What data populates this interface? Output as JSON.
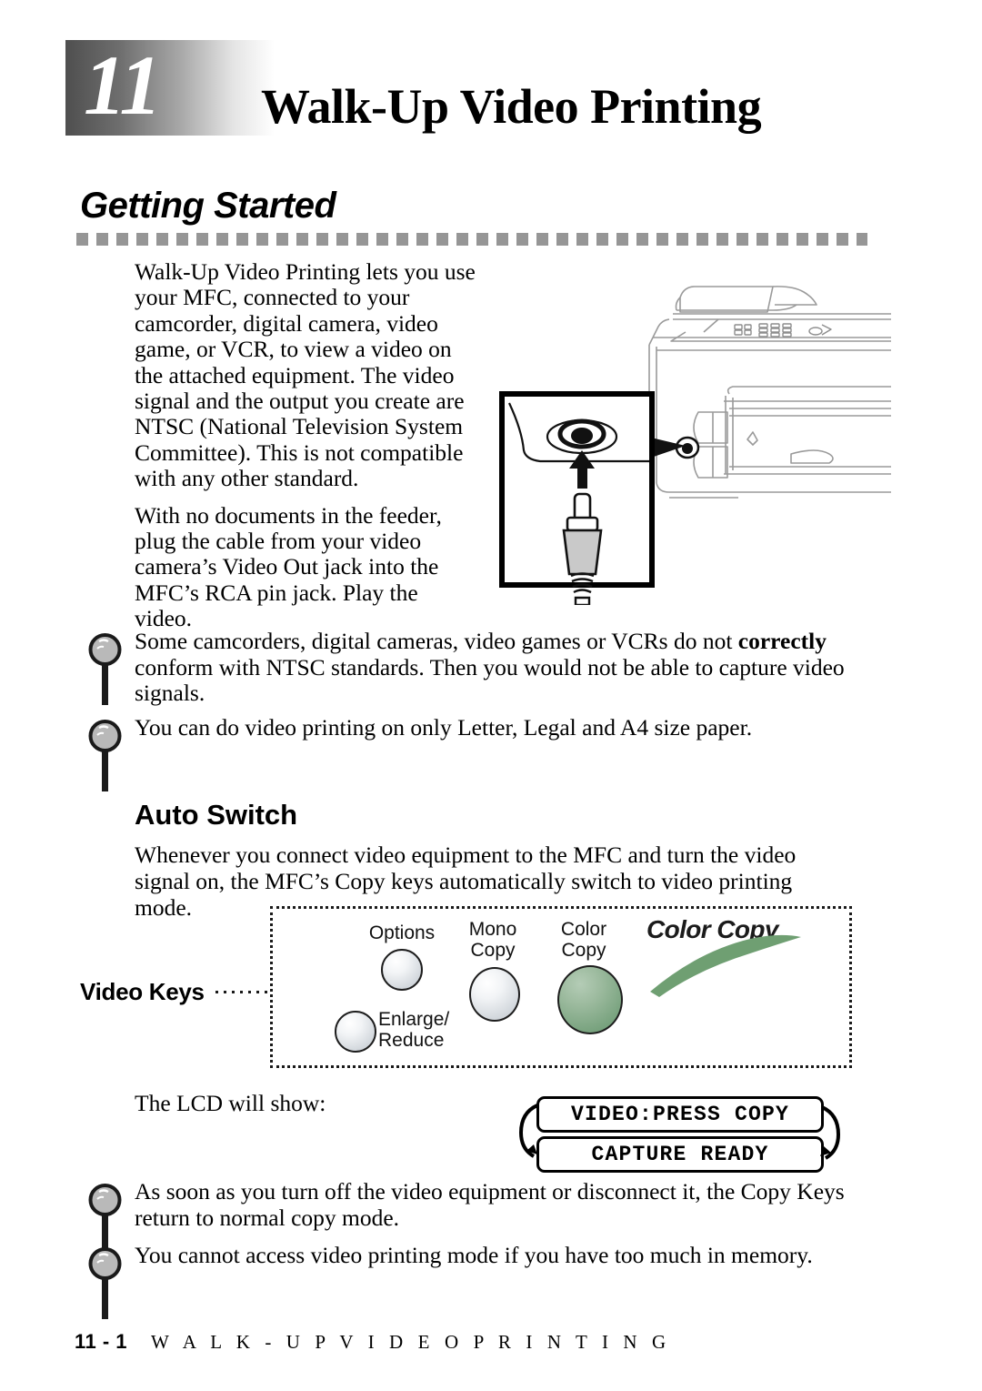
{
  "chapter": {
    "number": "11",
    "title": "Walk-Up Video Printing"
  },
  "section": {
    "heading": "Getting Started",
    "paragraphs": [
      "Walk-Up Video Printing lets you use your MFC, connected to your camcorder, digital camera, video game, or VCR, to view a video on the attached equipment. The video signal and the output you create are NTSC (National Television System Committee). This is not compatible with any other standard.",
      "With no documents in the feeder, plug the cable from your video camera’s Video Out jack into the MFC’s RCA pin jack. Play the video."
    ]
  },
  "notes_top": [
    {
      "icon": "magnifier-icon",
      "text_before": "Some camcorders, digital cameras, video games or VCRs do not ",
      "bold": "correctly",
      "text_after": " conform with NTSC standards. Then you would not be able to capture video signals."
    },
    {
      "icon": "magnifier-icon",
      "text_before": "You can do video printing on only Letter, Legal and A4 size paper.",
      "bold": "",
      "text_after": ""
    }
  ],
  "auto_switch": {
    "heading": "Auto Switch",
    "paragraph": "Whenever you connect video equipment to the MFC and turn the video signal on, the MFC’s Copy keys automatically switch to video printing mode."
  },
  "panel": {
    "callout_label": "Video Keys",
    "logo_text": "Color Copy",
    "logo_accent_color": "#6f9f72",
    "buttons": [
      {
        "label": "Options",
        "size": "small",
        "color": "#d8dde2"
      },
      {
        "label": "Enlarge/\nReduce",
        "size": "small",
        "color": "#d8dde2"
      },
      {
        "label": "Mono\nCopy",
        "size": "medium",
        "color": "#d8dde2"
      },
      {
        "label": "Color\nCopy",
        "size": "large",
        "color": "#7da585"
      }
    ],
    "button_labels": {
      "options": "Options",
      "enlarge_reduce_line1": "Enlarge/",
      "enlarge_reduce_line2": "Reduce",
      "mono_line1": "Mono",
      "mono_line2": "Copy",
      "color_line1": "Color",
      "color_line2": "Copy"
    }
  },
  "lcd": {
    "lead_in": "The LCD will show:",
    "line1": "VIDEO:PRESS COPY",
    "line2": "CAPTURE READY"
  },
  "notes_bottom": [
    {
      "icon": "magnifier-icon",
      "text_before": "As soon as you turn off the video equipment or disconnect it, the Copy Keys return to normal copy mode.",
      "bold": "",
      "text_after": ""
    },
    {
      "icon": "magnifier-icon",
      "text_before": "You cannot access video printing mode if you have too much in memory.",
      "bold": "",
      "text_after": ""
    }
  ],
  "footer": {
    "page_number": "11 - 1",
    "running_title": "W A L K - U P   V I D E O   P R I N T I N G"
  }
}
